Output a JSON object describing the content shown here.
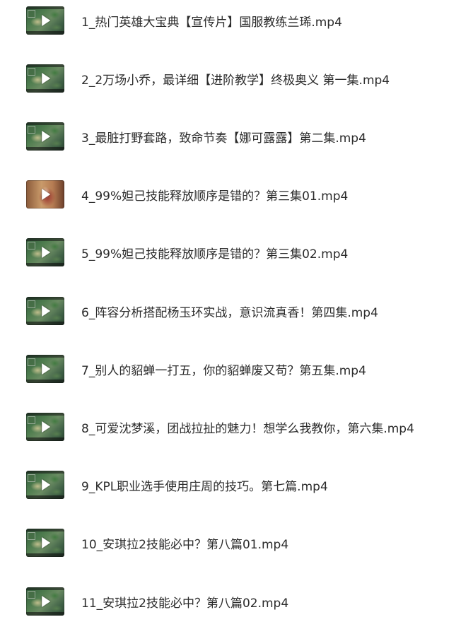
{
  "files": [
    {
      "name": "1_热门英雄大宝典【宣传片】国服教练兰琋.mp4",
      "thumb_icon": "video-thumbnail-icon"
    },
    {
      "name": "2_2万场小乔，最详细【进阶教学】终极奥义 第一集.mp4",
      "thumb_icon": "video-thumbnail-icon"
    },
    {
      "name": "3_最脏打野套路，致命节奏【娜可露露】第二集.mp4",
      "thumb_icon": "video-thumbnail-icon"
    },
    {
      "name": "4_99%妲己技能释放顺序是错的？第三集01.mp4",
      "thumb_icon": "video-thumbnail-icon"
    },
    {
      "name": "5_99%妲己技能释放顺序是错的？第三集02.mp4",
      "thumb_icon": "video-thumbnail-icon"
    },
    {
      "name": "6_阵容分析搭配杨玉环实战，意识流真香！第四集.mp4",
      "thumb_icon": "video-thumbnail-icon"
    },
    {
      "name": "7_别人的貂蝉一打五，你的貂蝉废又苟？第五集.mp4",
      "thumb_icon": "video-thumbnail-icon"
    },
    {
      "name": "8_可爱沈梦溪，团战拉扯的魅力！想学么我教你，第六集.mp4",
      "thumb_icon": "video-thumbnail-icon"
    },
    {
      "name": "9_KPL职业选手使用庄周的技巧。第七篇.mp4",
      "thumb_icon": "video-thumbnail-icon"
    },
    {
      "name": "10_安琪拉2技能必中？第八篇01.mp4",
      "thumb_icon": "video-thumbnail-icon"
    },
    {
      "name": "11_安琪拉2技能必中？第八篇02.mp4",
      "thumb_icon": "video-thumbnail-icon"
    }
  ]
}
